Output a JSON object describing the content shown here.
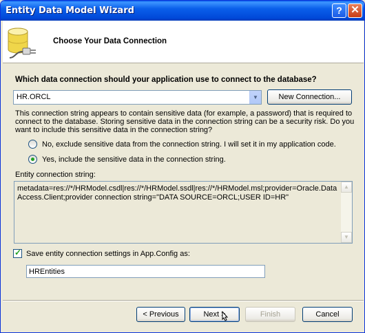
{
  "window": {
    "title": "Entity Data Model Wizard"
  },
  "title_buttons": {
    "help": "?",
    "close": "✕"
  },
  "header": {
    "title": "Choose Your Data Connection",
    "icon": "database-plug-icon"
  },
  "question": "Which data connection should your application use to connect to the database?",
  "connection": {
    "selected": "HR.ORCL",
    "new_button": "New Connection..."
  },
  "sensitive_text": "This connection string appears to contain sensitive data (for example, a password) that is required to connect to the database. Storing sensitive data in the connection string can be a security risk. Do you want to include this sensitive data in the connection string?",
  "options": {
    "exclude": {
      "label": "No, exclude sensitive data from the connection string. I will set it in my application code.",
      "checked": false
    },
    "include": {
      "label": "Yes, include the sensitive data in the connection string.",
      "checked": true
    }
  },
  "entity_string": {
    "label": "Entity connection string:",
    "value": "metadata=res://*/HRModel.csdl|res://*/HRModel.ssdl|res://*/HRModel.msl;provider=Oracle.DataAccess.Client;provider connection string=\"DATA SOURCE=ORCL;USER ID=HR\""
  },
  "save_settings": {
    "label": "Save entity connection settings in App.Config as:",
    "checked": true,
    "value": "HREntities"
  },
  "footer": {
    "previous": "< Previous",
    "next": "Next >",
    "finish": "Finish",
    "cancel": "Cancel"
  }
}
